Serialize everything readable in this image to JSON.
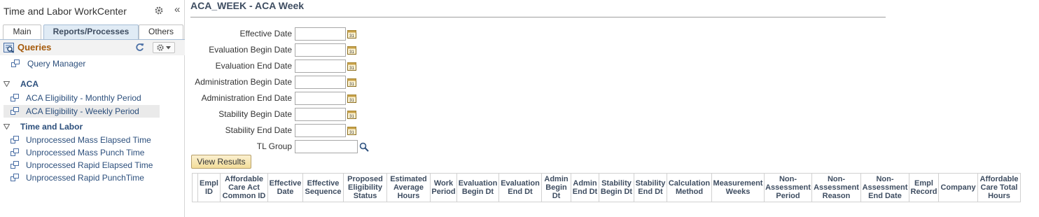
{
  "workcenter": {
    "title": "Time and Labor WorkCenter",
    "tabs": [
      {
        "label": "Main"
      },
      {
        "label": "Reports/Processes"
      },
      {
        "label": "Others"
      }
    ],
    "section": {
      "label": "Queries"
    },
    "query_manager": "Query Manager",
    "folders": [
      {
        "label": "ACA",
        "items": [
          "ACA Eligibility - Monthly Period",
          "ACA Eligibility - Weekly Period"
        ]
      },
      {
        "label": "Time and Labor",
        "items": [
          "Unprocessed Mass Elapsed Time",
          "Unprocessed Mass Punch Time",
          "Unprocessed Rapid Elapsed Time",
          "Unprocessed Rapid PunchTime"
        ]
      }
    ],
    "selected_item": "ACA Eligibility - Weekly Period"
  },
  "query": {
    "title": "ACA_WEEK - ACA Week",
    "prompts": [
      {
        "label": "Effective Date",
        "value": ""
      },
      {
        "label": "Evaluation Begin Date",
        "value": ""
      },
      {
        "label": "Evaluation End Date",
        "value": ""
      },
      {
        "label": "Administration Begin Date",
        "value": ""
      },
      {
        "label": "Administration End Date",
        "value": ""
      },
      {
        "label": "Stability Begin Date",
        "value": ""
      },
      {
        "label": "Stability End Date",
        "value": ""
      }
    ],
    "tl_group": {
      "label": "TL Group",
      "value": ""
    },
    "view_results_label": "View Results",
    "columns": [
      "Empl ID",
      "Affordable Care Act Common ID",
      "Effective Date",
      "Effective Sequence",
      "Proposed Eligibility Status",
      "Estimated Average Hours",
      "Work Period",
      "Evaluation Begin Dt",
      "Evaluation End Dt",
      "Admin Begin Dt",
      "Admin End Dt",
      "Stability Begin Dt",
      "Stability End Dt",
      "Calculation Method",
      "Measurement Weeks",
      "Non-Assessment Period",
      "Non-Assessment Reason",
      "Non-Assessment End Date",
      "Empl Record",
      "Company",
      "Affordable Care Total Hours"
    ]
  },
  "colors": {
    "link": "#2c4f7c",
    "section_label": "#a55a0b",
    "header_text": "#3e4d61",
    "button_face": "#f3dd9a"
  }
}
